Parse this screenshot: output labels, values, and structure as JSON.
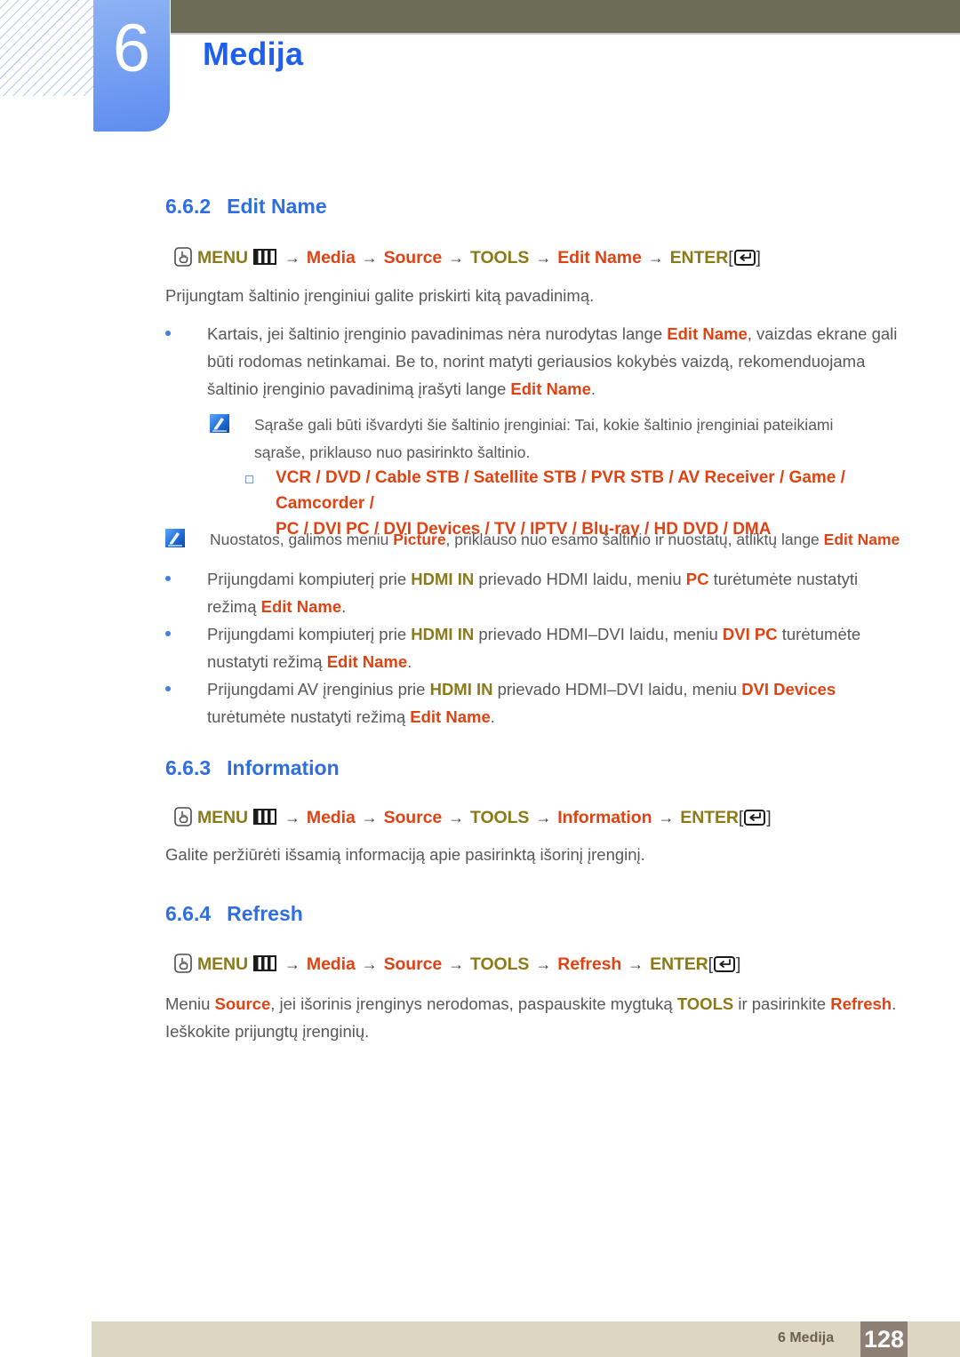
{
  "header": {
    "chapter_number": "6",
    "chapter_title": "Medija",
    "accent_blue": "#1f5ff0",
    "olive_bar_color": "#6d6c56"
  },
  "sections": [
    {
      "number": "6.6.2",
      "title": "Edit Name",
      "breadcrumb": {
        "menu": "MENU",
        "items": [
          "Media",
          "Source",
          "TOOLS",
          "Edit Name"
        ],
        "enter": "ENTER"
      },
      "intro": "Prijungtam šaltinio įrenginiui galite priskirti kitą pavadinimą."
    },
    {
      "number": "6.6.3",
      "title": "Information",
      "breadcrumb": {
        "menu": "MENU",
        "items": [
          "Media",
          "Source",
          "TOOLS",
          "Information"
        ],
        "enter": "ENTER"
      },
      "intro": "Galite peržiūrėti išsamią informaciją apie pasirinktą išorinį įrenginį."
    },
    {
      "number": "6.6.4",
      "title": "Refresh",
      "breadcrumb": {
        "menu": "MENU",
        "items": [
          "Media",
          "Source",
          "TOOLS",
          "Refresh"
        ],
        "enter": "ENTER"
      }
    }
  ],
  "bullet1": {
    "p1": "Kartais, jei šaltinio įrenginio pavadinimas nėra nurodytas lange ",
    "hl1": "Edit Name",
    "p2": ", vaizdas ekrane gali būti rodomas netinkamai. Be to, norint matyti geriausios kokybės vaizdą, rekomenduojama šaltinio įrenginio pavadinimą įrašyti lange ",
    "hl2": "Edit Name",
    "p3": "."
  },
  "note1": {
    "text": "Sąraše gali būti išvardyti šie šaltinio įrenginiai: Tai, kokie šaltinio įrenginiai pateikiami sąraše, priklauso nuo pasirinkto šaltinio."
  },
  "device_list": {
    "line1": "VCR / DVD / Cable STB / Satellite STB / PVR STB / AV Receiver / Game / Camcorder /",
    "line2": "PC / DVI PC / DVI Devices / TV / IPTV / Blu-ray / HD DVD / DMA"
  },
  "note2": {
    "p1": "Nuostatos, galimos meniu ",
    "hl1": "Picture",
    "p2": ", priklauso nuo esamo šaltinio ir nuostatų, atliktų lange ",
    "hl2": "Edit Name"
  },
  "bullet_hdmi1": {
    "p1": "Prijungdami kompiuterį prie ",
    "hl1": "HDMI IN",
    "p2": " prievado HDMI laidu, meniu ",
    "hl2": "PC",
    "p3": " turėtumėte nustatyti režimą ",
    "hl3": "Edit Name",
    "p4": "."
  },
  "bullet_hdmi2": {
    "p1": "Prijungdami kompiuterį prie ",
    "hl1": "HDMI IN",
    "p2": " prievado HDMI–DVI laidu, meniu ",
    "hl2": "DVI PC",
    "p3": " turėtumėte nustatyti režimą ",
    "hl3": "Edit Name",
    "p4": "."
  },
  "bullet_hdmi3": {
    "p1": "Prijungdami AV įrenginius prie ",
    "hl1": "HDMI IN",
    "p2": " prievado HDMI–DVI laidu, meniu ",
    "hl2": "DVI Devices",
    "p3": " turėtumėte nustatyti režimą ",
    "hl3": "Edit Name",
    "p4": "."
  },
  "refresh_body": {
    "p1": "Meniu ",
    "hl1": "Source",
    "p2": ", jei išorinis įrenginys nerodomas, paspauskite mygtuką ",
    "hl2": "TOOLS",
    "p3": " ir pasirinkite ",
    "hl3": "Refresh",
    "p4": ". Ieškokite prijungtų įrenginių."
  },
  "footer": {
    "label": "6 Medija",
    "page_number": "128"
  }
}
